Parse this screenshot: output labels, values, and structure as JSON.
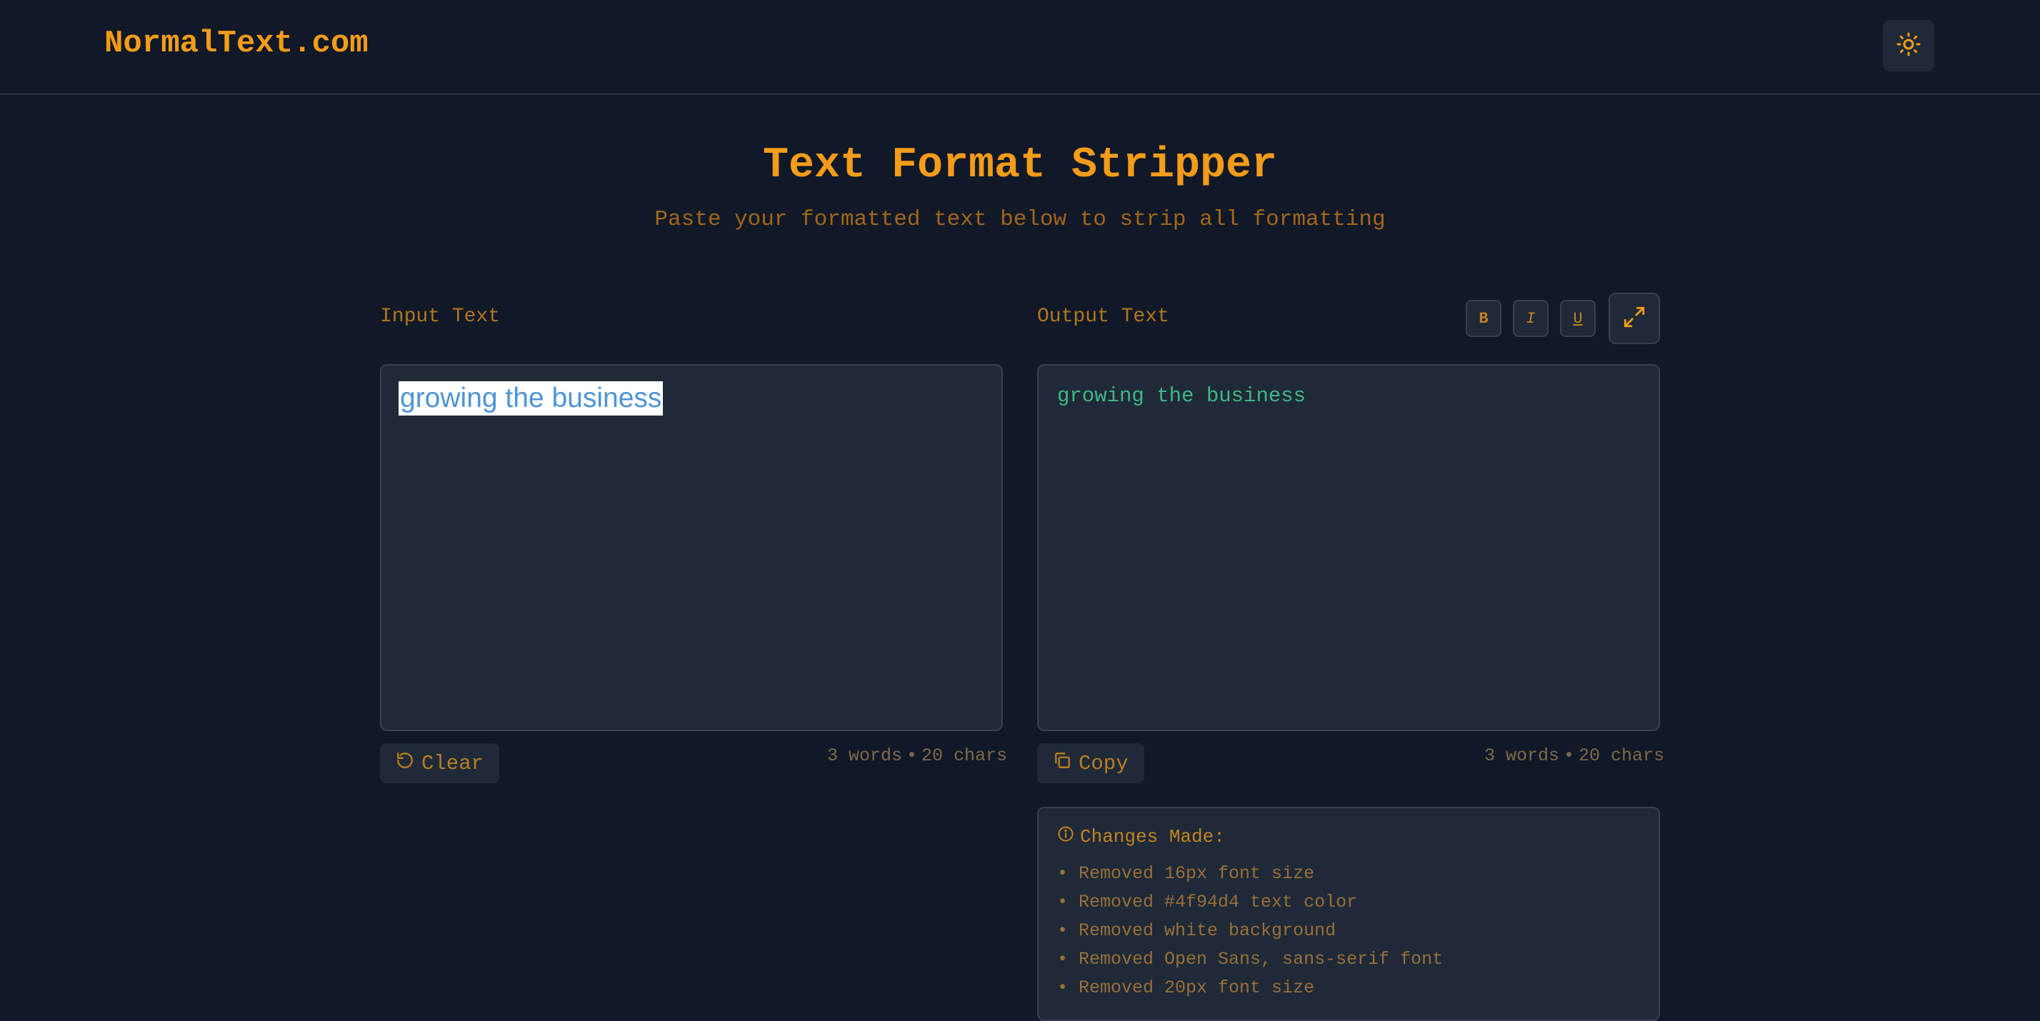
{
  "header": {
    "logo": "NormalText.com",
    "theme_toggle_icon": "sun-icon"
  },
  "main": {
    "title": "Text Format Stripper",
    "subtitle": "Paste your formatted text below to strip all formatting"
  },
  "input_panel": {
    "label": "Input Text",
    "value": "growing the business",
    "word_count": "3 words",
    "char_count": "20 chars",
    "clear_label": "Clear"
  },
  "output_panel": {
    "label": "Output Text",
    "value": "growing the business",
    "word_count": "3 words",
    "char_count": "20 chars",
    "copy_label": "Copy",
    "format_buttons": {
      "bold": "B",
      "italic": "I",
      "underline": "U"
    }
  },
  "changes": {
    "title": "Changes Made:",
    "items": [
      "Removed 16px font size",
      "Removed #4f94d4 text color",
      "Removed white background",
      "Removed Open Sans, sans-serif font",
      "Removed 20px font size"
    ]
  },
  "colors": {
    "background": "#111827",
    "panel": "#1f2937",
    "accent": "#f39c1a",
    "output_text": "#3fb884",
    "input_text": "#4f94d4"
  }
}
